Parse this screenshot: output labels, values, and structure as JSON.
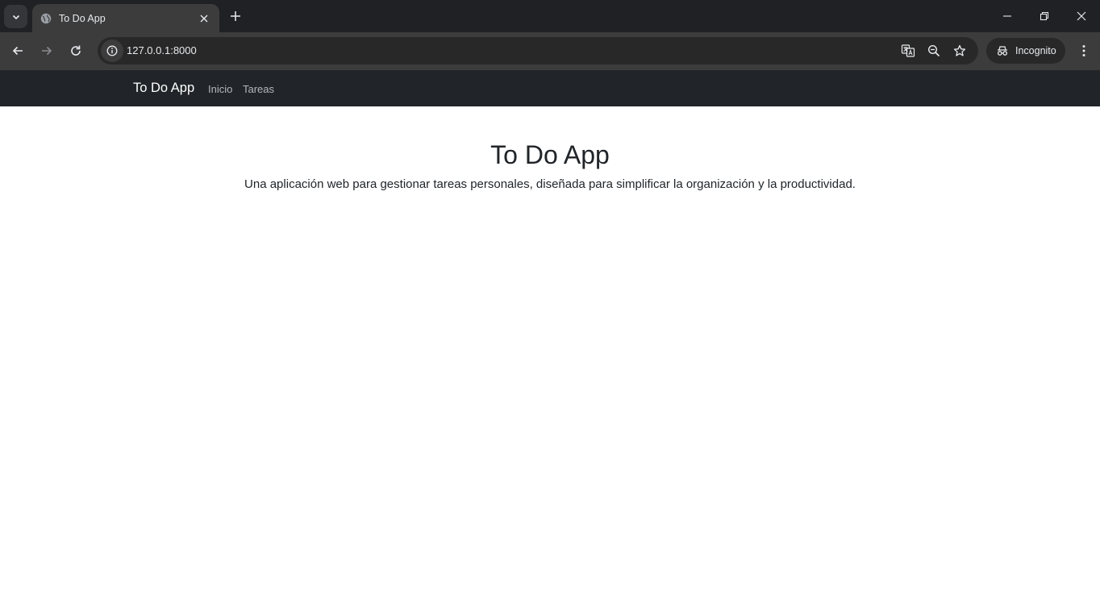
{
  "browser": {
    "tab_title": "To Do App",
    "url": "127.0.0.1:8000",
    "incognito_label": "Incognito",
    "icons": {
      "tab_search": "chevron-down-icon",
      "favicon": "globe-icon",
      "tab_close": "close-icon",
      "new_tab": "plus-icon",
      "back": "arrow-left-icon",
      "forward": "arrow-right-icon",
      "reload": "reload-icon",
      "site_info": "info-icon",
      "translate": "translate-icon",
      "zoom": "zoom-out-icon",
      "bookmark": "star-icon",
      "incognito": "incognito-icon",
      "menu": "kebab-menu-icon"
    },
    "colors": {
      "tabstrip": "#202124",
      "toolbar": "#3c3c3c",
      "omnibox": "#282828"
    }
  },
  "navbar": {
    "brand": "To Do App",
    "links": [
      {
        "label": "Inicio"
      },
      {
        "label": "Tareas"
      }
    ],
    "colors": {
      "background": "#212529",
      "brand": "#ffffff",
      "link": "#b4b7ba"
    }
  },
  "hero": {
    "title": "To Do App",
    "subtitle": "Una aplicación web para gestionar tareas personales, diseñada para simplificar la organización y la productividad."
  }
}
